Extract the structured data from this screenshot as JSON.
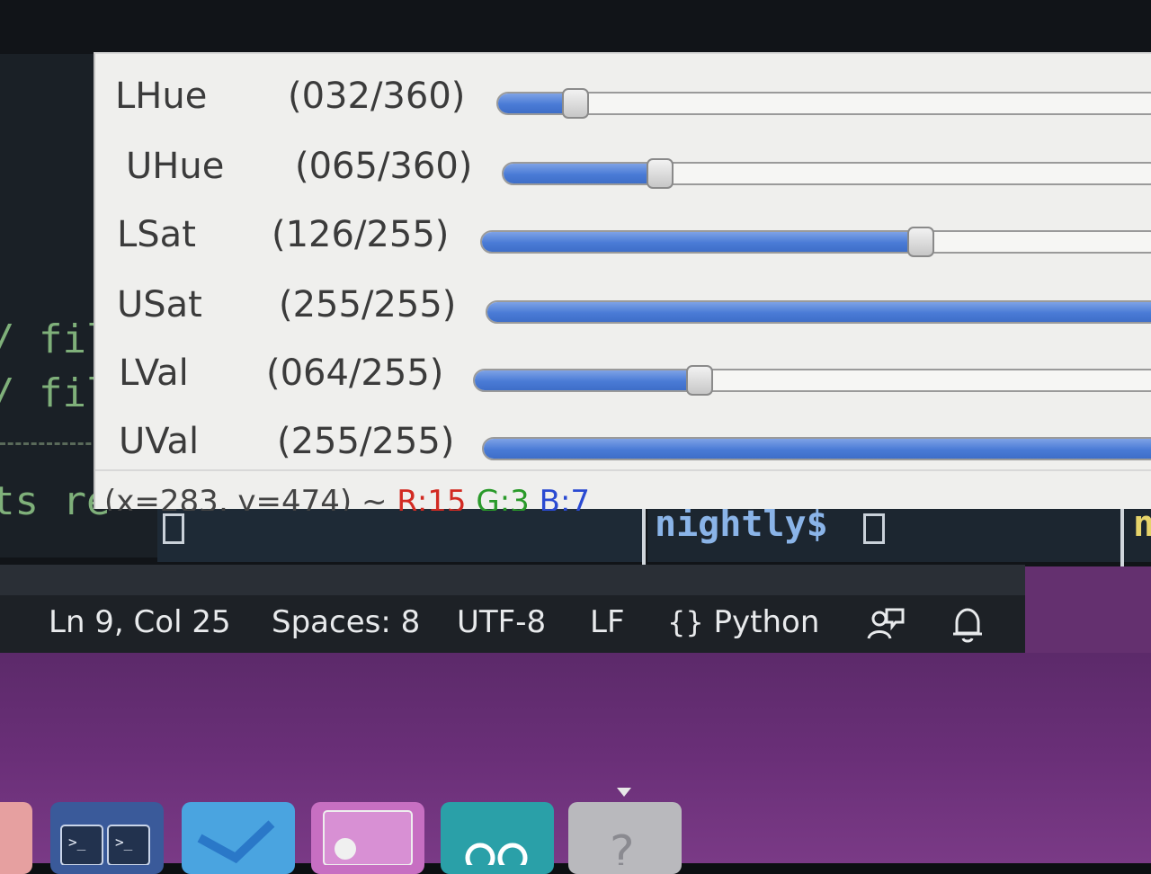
{
  "terminal": {
    "left_lines": [
      "/ fil",
      "/ fil",
      "ts re"
    ],
    "prompt": "nightly$",
    "prompt_far": "n"
  },
  "trackbars": [
    {
      "name": "LHue",
      "value_text": "(032/360)",
      "value": 32,
      "max": 360
    },
    {
      "name": "UHue",
      "value_text": "(065/360)",
      "value": 65,
      "max": 360
    },
    {
      "name": "LSat",
      "value_text": "(126/255)",
      "value": 126,
      "max": 255
    },
    {
      "name": "USat",
      "value_text": "(255/255)",
      "value": 255,
      "max": 255
    },
    {
      "name": "LVal",
      "value_text": "(064/255)",
      "value": 64,
      "max": 255
    },
    {
      "name": "UVal",
      "value_text": "(255/255)",
      "value": 255,
      "max": 255
    }
  ],
  "pixel_info": {
    "xy": "(x=283, y=474) ~",
    "r": "R:15",
    "g": "G:3",
    "b": "B:7"
  },
  "status_bar": {
    "position": "Ln 9, Col 25",
    "spaces": "Spaces: 8",
    "encoding": "UTF-8",
    "eol": "LF",
    "language_icon": "{}",
    "language": "Python",
    "feedback_icon": "feedback-icon",
    "bell_icon": "bell-icon"
  },
  "colors": {
    "slider_fill": "#4a7bd6",
    "window_bg": "#efefed",
    "status_bg": "#1d2126",
    "desktop": "#6a2f78"
  },
  "dock": {
    "icons": [
      "files-icon",
      "terminal-icon",
      "vscode-icon",
      "app-icon",
      "arduino-icon",
      "unknown-app-icon"
    ]
  }
}
